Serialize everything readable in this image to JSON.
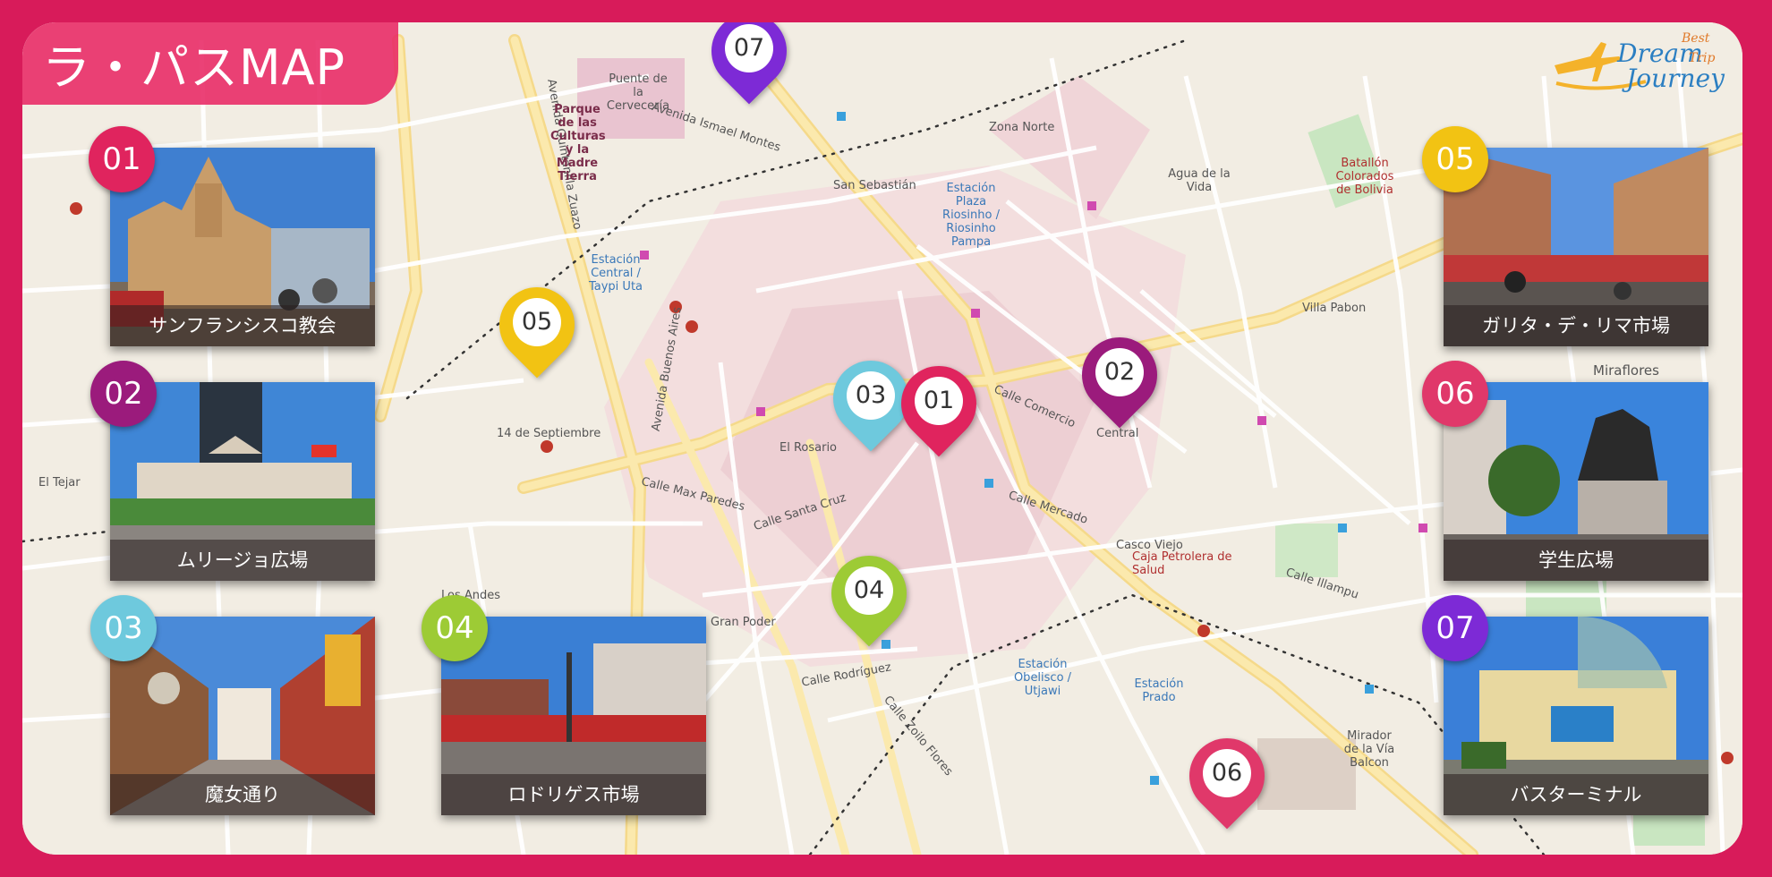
{
  "title": "ラ・パスMAP",
  "logo": {
    "line1": "Best",
    "line2": "Dream",
    "line3": "Trip",
    "line4": "Journey"
  },
  "colors": {
    "frame": "#d81b5a",
    "c01": "#e0245e",
    "c02": "#9b1b7c",
    "c03": "#6ec9dd",
    "c04": "#9dcb35",
    "c05": "#f2c313",
    "c06": "#e0386a",
    "c07": "#7d2ad6"
  },
  "cards": [
    {
      "num": "01",
      "caption": "サンフランシスコ教会"
    },
    {
      "num": "02",
      "caption": "ムリージョ広場"
    },
    {
      "num": "03",
      "caption": "魔女通り"
    },
    {
      "num": "04",
      "caption": "ロドリゲス市場"
    },
    {
      "num": "05",
      "caption": "ガリタ・デ・リマ市場"
    },
    {
      "num": "06",
      "caption": "学生広場"
    },
    {
      "num": "07",
      "caption": "バスターミナル"
    }
  ],
  "pins": [
    "07",
    "05",
    "03",
    "01",
    "02",
    "04",
    "06"
  ],
  "map_labels": [
    "Zona Norte",
    "San Sebastián",
    "Agua de la Vida",
    "Villa Pabon",
    "Miraflores",
    "El Rosario",
    "Central",
    "Casco Viejo",
    "Gran Poder",
    "Los Andes",
    "El Tejar",
    "14 de Septiembre",
    "Avenida Ismael Montes",
    "Calle Max Paredes",
    "Calle Santa Cruz",
    "Calle Comercio",
    "Calle Mercado",
    "Avenida Quintanilla Zuazo",
    "Parque de las Culturas y la Madre Tierra",
    "Estación Central / Taypi Uta",
    "Estación Plaza Riosinho / Riosinho Pampa",
    "Estación Obelisco / Utjawi",
    "Estación Prado",
    "Caja Petrolera de Salud",
    "Batallón Colorados de Bolivia",
    "Mirador de la Vía Balcon",
    "Puente de la Cervecería",
    "Calle Illampu",
    "Calle Rodríguez",
    "Calle Zoilo Flores",
    "Avenida Buenos Aires"
  ]
}
